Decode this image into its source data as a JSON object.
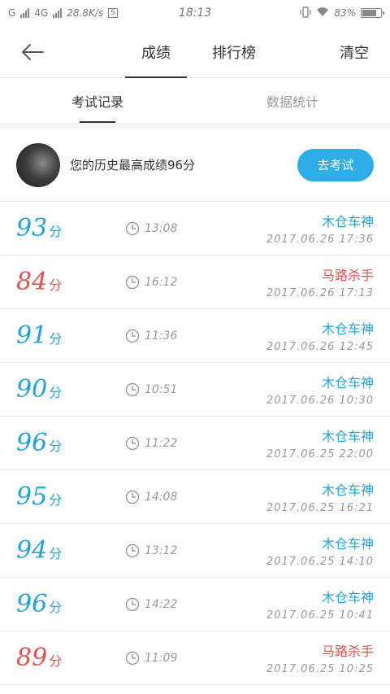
{
  "status_bar": {
    "carrier": "G",
    "network": "4G",
    "speed": "28.8K/s",
    "time": "18:13",
    "battery": "83%",
    "battery_level": 0.83
  },
  "nav": {
    "tabs": [
      {
        "label": "成绩",
        "active": true
      },
      {
        "label": "排行榜",
        "active": false
      }
    ],
    "clear_label": "清空"
  },
  "sub_tabs": [
    {
      "label": "考试记录",
      "active": true
    },
    {
      "label": "数据统计",
      "active": false
    }
  ],
  "summary": {
    "text": "您的历史最高成绩96分",
    "button_label": "去考试"
  },
  "colors": {
    "accent_blue": "#1fa3d8",
    "warn_red": "#e05050",
    "button_blue": "#2daee6"
  },
  "records": [
    {
      "score": "93",
      "unit": "分",
      "duration": "13:08",
      "name": "木仓车神",
      "datetime": "2017.06.26  17:36",
      "color": "blue"
    },
    {
      "score": "84",
      "unit": "分",
      "duration": "16:12",
      "name": "马路杀手",
      "datetime": "2017.06.26  17:13",
      "color": "red"
    },
    {
      "score": "91",
      "unit": "分",
      "duration": "11:36",
      "name": "木仓车神",
      "datetime": "2017.06.26  12:45",
      "color": "blue"
    },
    {
      "score": "90",
      "unit": "分",
      "duration": "10:51",
      "name": "木仓车神",
      "datetime": "2017.06.26  10:30",
      "color": "blue"
    },
    {
      "score": "96",
      "unit": "分",
      "duration": "11:22",
      "name": "木仓车神",
      "datetime": "2017.06.25  22:00",
      "color": "blue"
    },
    {
      "score": "95",
      "unit": "分",
      "duration": "14:08",
      "name": "木仓车神",
      "datetime": "2017.06.25  16:21",
      "color": "blue"
    },
    {
      "score": "94",
      "unit": "分",
      "duration": "13:12",
      "name": "木仓车神",
      "datetime": "2017.06.25  14:10",
      "color": "blue"
    },
    {
      "score": "96",
      "unit": "分",
      "duration": "14:22",
      "name": "木仓车神",
      "datetime": "2017.06.25  10:41",
      "color": "blue"
    },
    {
      "score": "89",
      "unit": "分",
      "duration": "11:09",
      "name": "马路杀手",
      "datetime": "2017.06.25  10:25",
      "color": "red"
    }
  ]
}
